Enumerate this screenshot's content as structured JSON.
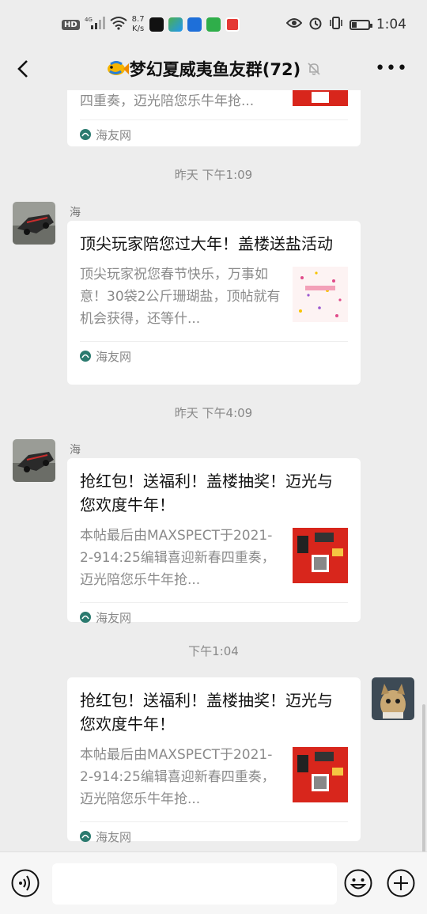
{
  "status_bar": {
    "hd_label": "HD",
    "network_label": "4G",
    "speed_value": "8.7",
    "speed_unit": "K/s",
    "time": "1:04"
  },
  "header": {
    "title": "梦幻夏威夷鱼友群(72)",
    "back_icon": "chevron-left-icon",
    "more_label": "•••"
  },
  "messages": [
    {
      "type": "link-card-partial",
      "desc_tail": "四重奏，迈光陪您乐牛年抢...",
      "source": "海友网"
    },
    {
      "timestamp": "昨天 下午1:09",
      "sender": "海",
      "title": "顶尖玩家陪您过大年！盖楼送盐活动",
      "desc": "顶尖玩家祝您春节快乐，万事如意！30袋2公斤珊瑚盐，顶帖就有机会获得，还等什...",
      "source": "海友网"
    },
    {
      "timestamp": "昨天 下午4:09",
      "sender": "海",
      "title": "抢红包！送福利！盖楼抽奖！迈光与您欢度牛年！",
      "desc": "本帖最后由MAXSPECT于2021-2-914:25编辑喜迎新春四重奏，迈光陪您乐牛年抢...",
      "source": "海友网"
    },
    {
      "timestamp": "下午1:04",
      "sender": "",
      "title": "抢红包！送福利！盖楼抽奖！迈光与您欢度牛年！",
      "desc": "本帖最后由MAXSPECT于2021-2-914:25编辑喜迎新春四重奏，迈光陪您乐牛年抢...",
      "source": "海友网"
    }
  ],
  "input_bar": {
    "placeholder": ""
  },
  "colors": {
    "background": "#ededed",
    "card": "#ffffff",
    "muted_text": "#8a8a8a",
    "red_thumb": "#d8261c"
  },
  "battery_level": 0.3
}
